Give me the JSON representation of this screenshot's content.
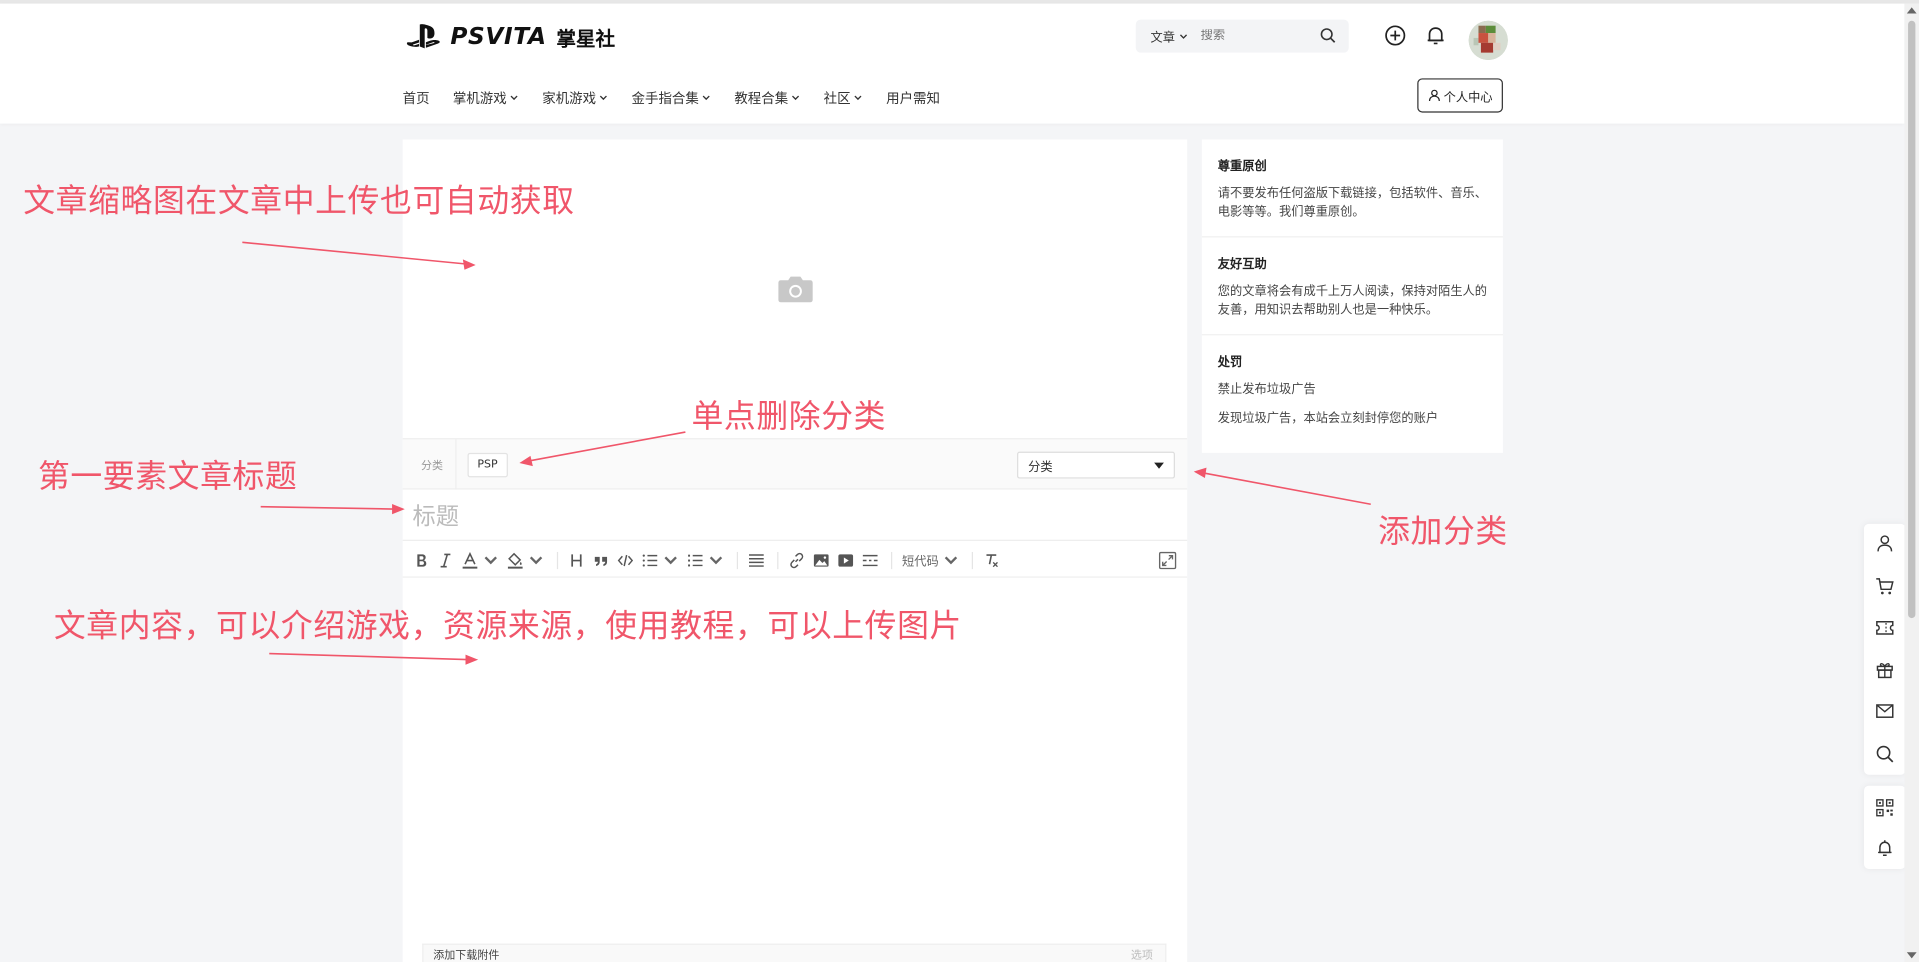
{
  "header": {
    "logo_text": "PSVITA",
    "logo_cn": "掌星社",
    "search_type": "文章",
    "search_placeholder": "搜索",
    "user_center_label": "个人中心"
  },
  "nav": {
    "items": [
      {
        "label": "首页",
        "dropdown": false
      },
      {
        "label": "掌机游戏",
        "dropdown": true
      },
      {
        "label": "家机游戏",
        "dropdown": true
      },
      {
        "label": "金手指合集",
        "dropdown": true
      },
      {
        "label": "教程合集",
        "dropdown": true
      },
      {
        "label": "社区",
        "dropdown": true
      },
      {
        "label": "用户需知",
        "dropdown": false
      }
    ]
  },
  "editor": {
    "category_label": "分类",
    "category_tag": "PSP",
    "category_select": "分类",
    "title_placeholder": "标题",
    "short_code_label": "短代码",
    "attach_label": "添加下载附件",
    "attach_right": "选项"
  },
  "sidebar": {
    "blocks": [
      {
        "title": "尊重原创",
        "texts": [
          "请不要发布任何盗版下载链接，包括软件、音乐、电影等等。我们尊重原创。"
        ]
      },
      {
        "title": "友好互助",
        "texts": [
          "您的文章将会有成千上万人阅读，保持对陌生人的友善，用知识去帮助别人也是一种快乐。"
        ]
      },
      {
        "title": "处罚",
        "texts": [
          "禁止发布垃圾广告",
          "发现垃圾广告，本站会立刻封停您的账户"
        ]
      }
    ]
  },
  "annotations": {
    "cover": "文章缩略图在文章中上传也可自动获取",
    "delete_category": "单点删除分类",
    "title": "第一要素文章标题",
    "add_category": "添加分类",
    "content": "文章内容，可以介绍游戏，资源来源，使用教程，可以上传图片"
  },
  "colors": {
    "annotation": "#f0566a",
    "page_bg": "#f4f5f7"
  }
}
